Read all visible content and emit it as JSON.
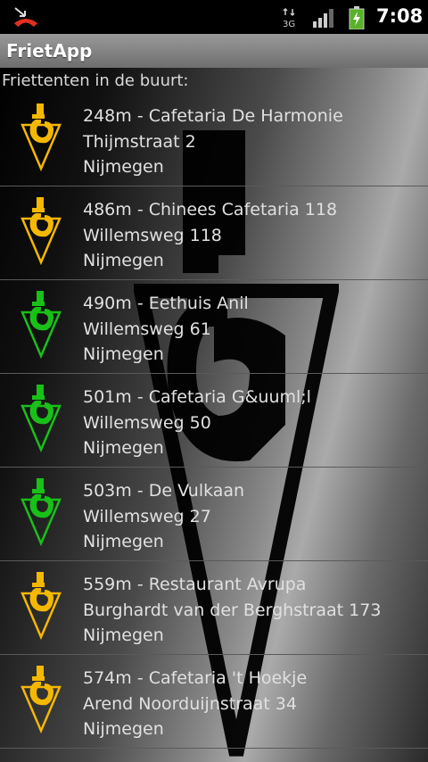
{
  "status_bar": {
    "time": "7:08",
    "network": "3G",
    "icons": [
      "missed-call-icon",
      "network-3g-icon",
      "signal-icon",
      "battery-charging-icon"
    ]
  },
  "app": {
    "title": "FrietApp"
  },
  "list": {
    "header": "Friettenten in de buurt:",
    "items": [
      {
        "title": "248m - Cafetaria De Harmonie",
        "street": "Thijmstraat 2",
        "city": "Nijmegen",
        "icon_color": "yellow"
      },
      {
        "title": "486m - Chinees Cafetaria 118",
        "street": "Willemsweg 118",
        "city": "Nijmegen",
        "icon_color": "yellow"
      },
      {
        "title": "490m - Eethuis Anil",
        "street": "Willemsweg 61",
        "city": "Nijmegen",
        "icon_color": "green"
      },
      {
        "title": "501m - Cafetaria G&uuml;l",
        "street": "Willemsweg 50",
        "city": "Nijmegen",
        "icon_color": "green"
      },
      {
        "title": "503m - De Vulkaan",
        "street": "Willemsweg 27",
        "city": "Nijmegen",
        "icon_color": "green"
      },
      {
        "title": "559m - Restaurant Avrupa",
        "street": "Burghardt van der Berghstraat 173",
        "city": "Nijmegen",
        "icon_color": "yellow"
      },
      {
        "title": "574m - Cafetaria 't Hoekje",
        "street": "Arend Noorduijnstraat 34",
        "city": "Nijmegen",
        "icon_color": "yellow"
      }
    ]
  },
  "colors": {
    "yellow": "#f5b800",
    "green": "#18c018",
    "title_bar": "#808080"
  }
}
